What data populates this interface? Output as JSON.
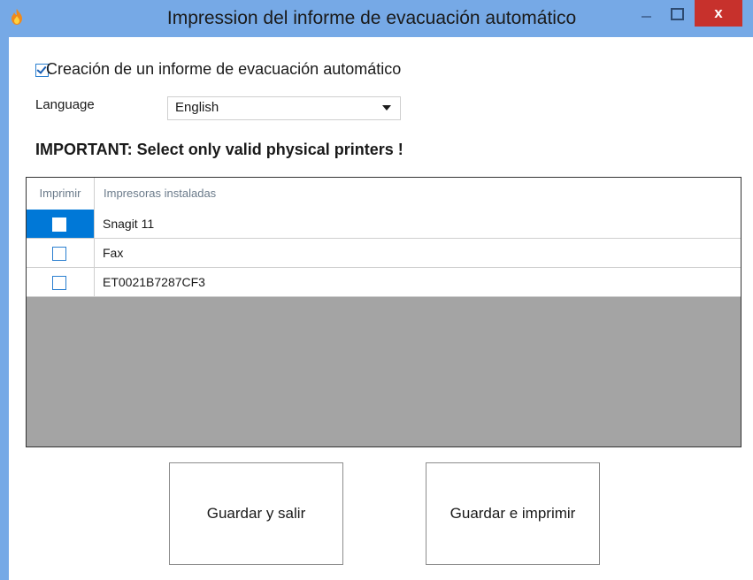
{
  "window": {
    "title": "Impression del informe de evacuación automático",
    "close_symbol": "x",
    "icons": {
      "app": "fire-icon",
      "minimize": "minimize-icon",
      "maximize": "maximize-icon",
      "close": "close-icon"
    }
  },
  "auto_report": {
    "label": "Creación de un informe de evacuación automático",
    "checked": true
  },
  "language": {
    "label": "Language",
    "selected": "English"
  },
  "warning": "IMPORTANT: Select only valid physical printers !",
  "printers_table": {
    "columns": [
      "Imprimir",
      "Impresoras instaladas"
    ],
    "rows": [
      {
        "print": false,
        "name": "Snagit 11",
        "selected": true
      },
      {
        "print": false,
        "name": "Fax",
        "selected": false
      },
      {
        "print": false,
        "name": "ET0021B7287CF3",
        "selected": false
      }
    ]
  },
  "buttons": {
    "save_exit": "Guardar y salir",
    "save_print": "Guardar e imprimir"
  },
  "colors": {
    "titlebar": "#76a9e6",
    "close_button": "#c7312c",
    "selection": "#0078d7",
    "grid_empty": "#a4a4a4"
  }
}
